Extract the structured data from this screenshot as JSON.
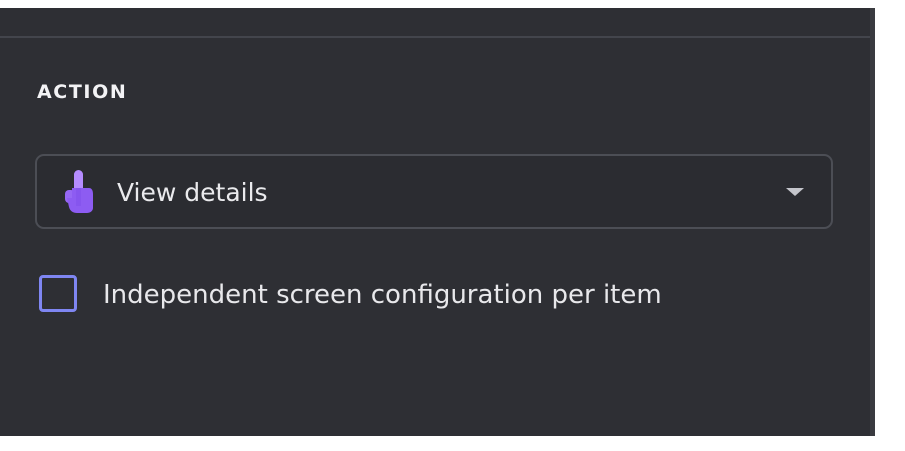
{
  "section": {
    "title": "ACTION"
  },
  "action_dropdown": {
    "selected": "View details",
    "icon": "tap-finger-icon",
    "accent_color": "#9b6dff"
  },
  "independent_config": {
    "label": "Independent screen configuration per item",
    "checked": false,
    "checkbox_color": "#7f86f2"
  }
}
